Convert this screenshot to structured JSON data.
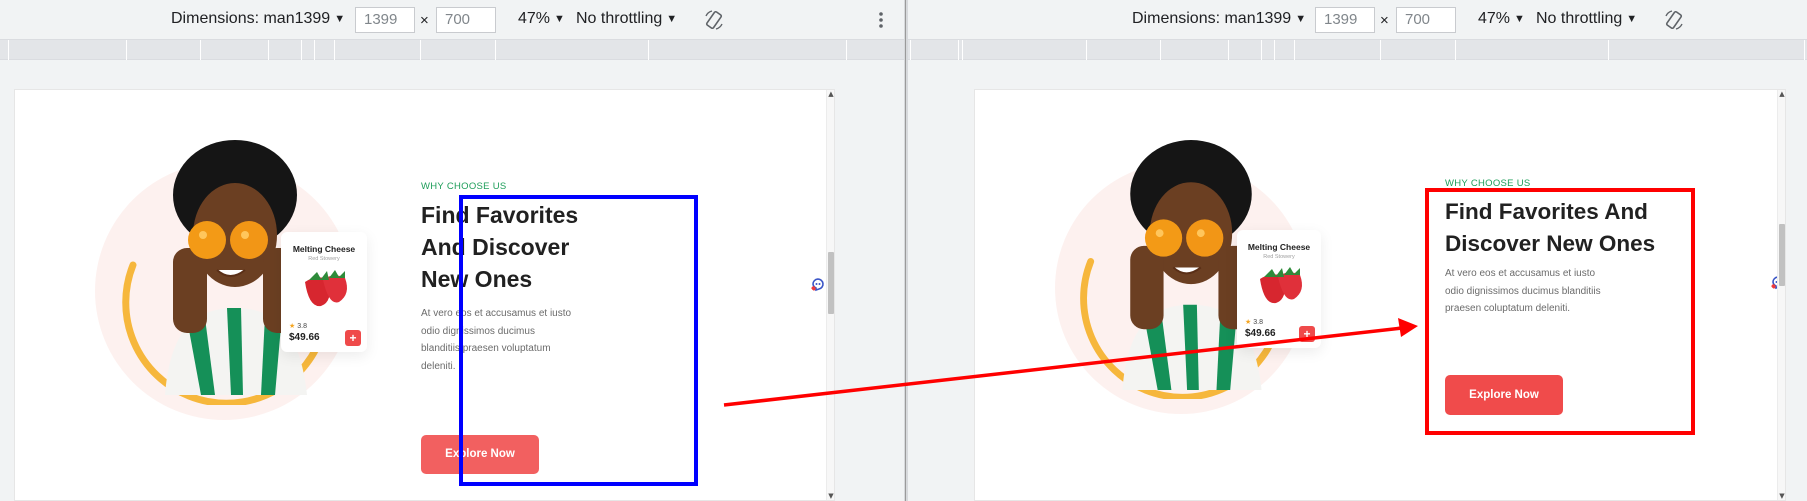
{
  "toolbar": {
    "dimensions_label": "Dimensions: man1399",
    "width_value": "1399",
    "height_value": "700",
    "times": "×",
    "zoom": "47%",
    "throttling": "No throttling"
  },
  "product_card": {
    "title": "Melting Cheese",
    "subtitle": "Red Stowery",
    "rating": "3.8",
    "price": "$49.66",
    "add_label": "+"
  },
  "section": {
    "eyebrow": "WHY CHOOSE US",
    "heading_left": [
      "Find Favorites",
      "And Discover",
      "New Ones"
    ],
    "heading_right": [
      "Find Favorites And",
      "Discover New Ones"
    ],
    "description_left": [
      "At vero eos et accusamus et iusto",
      "odio dignissimos ducimus",
      "blanditiis praesen voluptatum",
      "deleniti."
    ],
    "description_right": [
      "At vero eos et accusamus et iusto",
      "odio dignissimos ducimus blanditiis",
      "praesen coluptatum deleniti."
    ],
    "cta": "Explore Now"
  },
  "colors": {
    "highlight_left": "#0000ff",
    "highlight_right": "#ff0000",
    "arrow": "#ff0000",
    "accent_green": "#1e9e5a",
    "cta_red": "#f26060",
    "arc_yellow": "#f6b73c"
  }
}
